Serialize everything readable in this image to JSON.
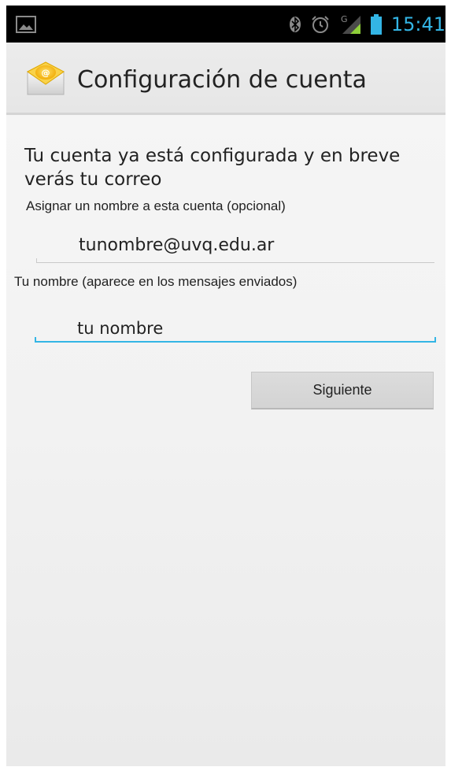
{
  "status_bar": {
    "time": "15:41",
    "left_icon": "image-notification-icon",
    "icons": [
      "bluetooth-icon",
      "alarm-clock-icon",
      "signal-icon",
      "battery-icon"
    ],
    "accent_color": "#33b5e5"
  },
  "action_bar": {
    "icon": "email-envelope-icon",
    "title": "Configuración de cuenta"
  },
  "main": {
    "heading": "Tu cuenta ya está configurada y en breve verás tu correo",
    "account_name": {
      "label": "Asignar un nombre a esta cuenta (opcional)",
      "value": "tunombre@uvq.edu.ar"
    },
    "your_name": {
      "label": "Tu nombre (aparece en los mensajes enviados)",
      "value": "tu nombre",
      "focused": true
    },
    "next_button_label": "Siguiente"
  }
}
